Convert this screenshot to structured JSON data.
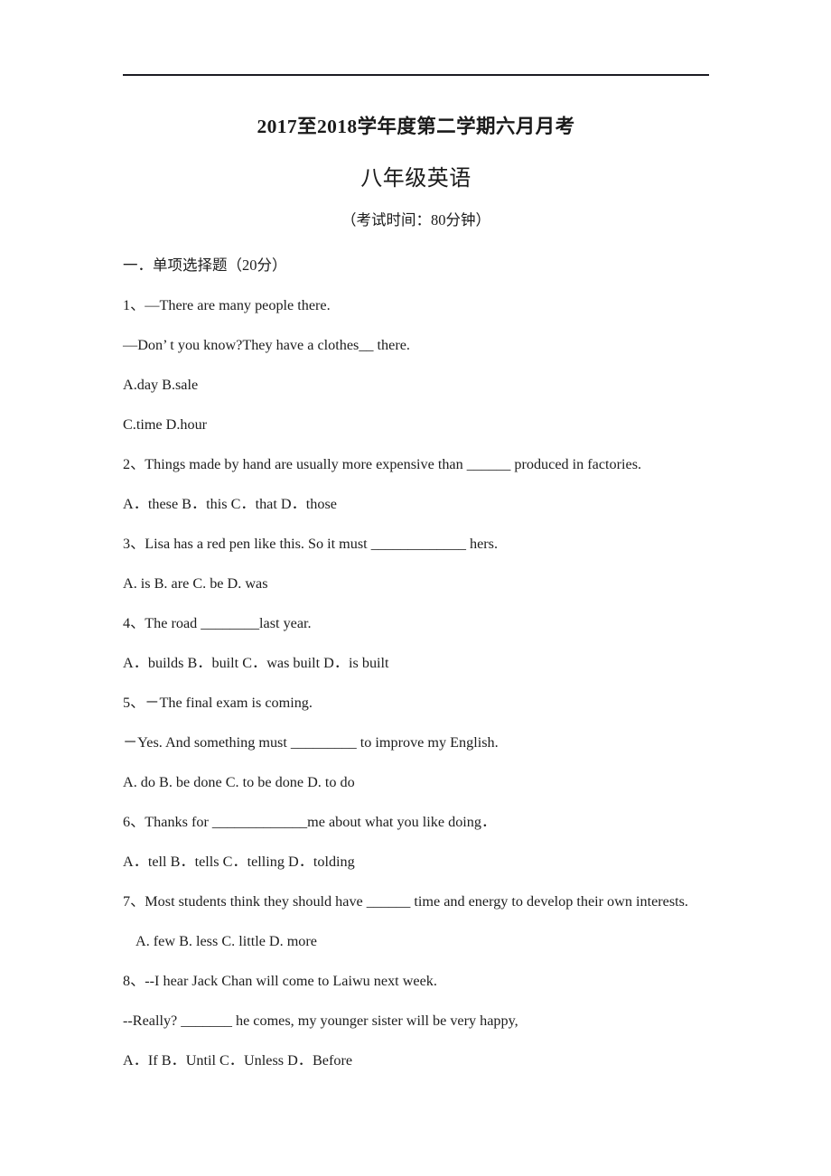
{
  "document": {
    "title": "2017至2018学年度第二学期六月月考",
    "subtitle": "八年级英语",
    "exam_time": "（考试时间：80分钟）"
  },
  "section": {
    "heading": "一．单项选择题（20分）"
  },
  "questions": [
    {
      "number": "1、",
      "lines": [
        "1、—There are many people there.",
        "—Don’ t you know?They have a clothes__ there."
      ],
      "option_lines": [
        "A.day            B.sale",
        "C.time          D.hour"
      ]
    },
    {
      "number": "2、",
      "lines": [
        "2、Things made by hand are usually more expensive than ______ produced in factories."
      ],
      "option_lines": [
        "A．these   B．this    C．that    D．those"
      ]
    },
    {
      "number": "3、",
      "lines": [
        "3、Lisa has a red pen like this. So it must _____________ hers."
      ],
      "option_lines": [
        "A. is    B. are    C. be      D. was"
      ]
    },
    {
      "number": "4、",
      "lines": [
        "4、The road ________last year."
      ],
      "option_lines": [
        "A．builds   B．built    C．was built     D．is built"
      ]
    },
    {
      "number": "5、",
      "lines": [
        "5、－The final exam is coming.",
        "－Yes. And something must _________ to improve my English."
      ],
      "option_lines": [
        "A. do    B. be done     C. to be done     D. to do"
      ]
    },
    {
      "number": "6、",
      "lines": [
        "6、Thanks for _____________me about what you like doing．"
      ],
      "option_lines": [
        "A．tell   B．tells    C．telling     D．tolding"
      ]
    },
    {
      "number": "7、",
      "lines": [
        "7、Most students think they should have ______ time and energy to develop their own interests."
      ],
      "option_lines": [
        "A. few     B. less     C. little     D. more"
      ]
    },
    {
      "number": "8、",
      "lines": [
        "8、--I hear Jack Chan will come to Laiwu next week.",
        "--Really? _______ he comes, my younger sister will be very happy,"
      ],
      "option_lines": [
        "A．If    B．Until     C．Unless     D．Before"
      ]
    }
  ],
  "body_lines": [
    {
      "text": "一．单项选择题（20分）",
      "name": "section-heading",
      "indent": false
    },
    {
      "text": "1、—There are many people there.",
      "name": "question-1-stem-line-1",
      "indent": false
    },
    {
      "text": "—Don’ t you know?They have a clothes__ there.",
      "name": "question-1-stem-line-2",
      "indent": false
    },
    {
      "text": "A.day            B.sale",
      "name": "question-1-options-row-1",
      "indent": false
    },
    {
      "text": "C.time          D.hour",
      "name": "question-1-options-row-2",
      "indent": false
    },
    {
      "text": "2、Things made by hand are usually more expensive than ______ produced in factories.",
      "name": "question-2-stem",
      "indent": false
    },
    {
      "text": "A．these   B．this    C．that    D．those",
      "name": "question-2-options",
      "indent": false
    },
    {
      "text": "3、Lisa has a red pen like this. So it must _____________ hers.",
      "name": "question-3-stem",
      "indent": false
    },
    {
      "text": "A. is    B. are    C. be      D. was",
      "name": "question-3-options",
      "indent": false
    },
    {
      "text": "4、The road ________last year.",
      "name": "question-4-stem",
      "indent": false
    },
    {
      "text": "A．builds   B．built    C．was built     D．is built",
      "name": "question-4-options",
      "indent": false
    },
    {
      "text": "5、－The final exam is coming.",
      "name": "question-5-stem-line-1",
      "indent": false
    },
    {
      "text": "－Yes. And something must _________ to improve my English.",
      "name": "question-5-stem-line-2",
      "indent": false
    },
    {
      "text": "A. do    B. be done     C. to be done     D. to do",
      "name": "question-5-options",
      "indent": false
    },
    {
      "text": "6、Thanks for _____________me about what you like doing．",
      "name": "question-6-stem",
      "indent": false
    },
    {
      "text": "A．tell   B．tells    C．telling     D．tolding",
      "name": "question-6-options",
      "indent": false
    },
    {
      "text": "7、Most students think they should have ______ time and energy to develop their own interests.",
      "name": "question-7-stem",
      "indent": false
    },
    {
      "text": "A. few     B. less     C. little     D. more",
      "name": "question-7-options",
      "indent": true
    },
    {
      "text": "8、--I hear Jack Chan will come to Laiwu next week.",
      "name": "question-8-stem-line-1",
      "indent": false
    },
    {
      "text": "--Really? _______ he comes, my younger sister will be very happy,",
      "name": "question-8-stem-line-2",
      "indent": false
    },
    {
      "text": "A．If    B．Until     C．Unless     D．Before",
      "name": "question-8-options",
      "indent": false
    }
  ]
}
